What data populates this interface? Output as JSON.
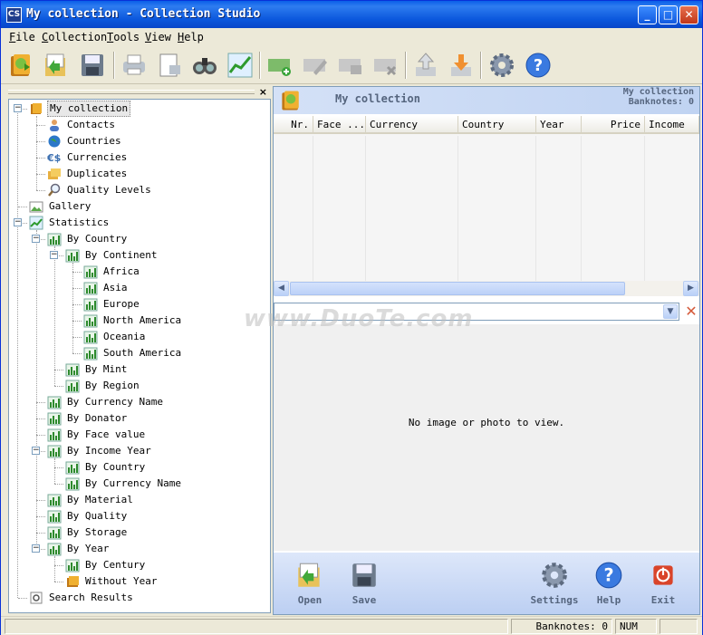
{
  "window": {
    "app_icon": "CS",
    "title": "My collection - Collection Studio"
  },
  "menu": [
    "File",
    "Collection",
    "Tools",
    "View",
    "Help"
  ],
  "toolbar_icons": [
    "open-book-icon",
    "open-folder-icon",
    "save-icon",
    "print-icon",
    "print-preview-icon",
    "binoculars-icon",
    "chart-icon",
    "add-item-icon",
    "edit-item-icon",
    "duplicate-item-icon",
    "delete-item-icon",
    "import-icon",
    "export-icon",
    "settings-icon",
    "help-icon"
  ],
  "left_panel": {
    "close_glyph": "×",
    "tree": [
      {
        "label": "My collection",
        "icon": "book-icon",
        "level": 0
      },
      {
        "label": "Contacts",
        "icon": "contact-icon",
        "level": 1
      },
      {
        "label": "Countries",
        "icon": "globe-icon",
        "level": 1
      },
      {
        "label": "Currencies",
        "icon": "currency-icon",
        "level": 1
      },
      {
        "label": "Duplicates",
        "icon": "duplicates-icon",
        "level": 1
      },
      {
        "label": "Quality Levels",
        "icon": "magnifier-icon",
        "level": 1
      },
      {
        "label": "Gallery",
        "icon": "gallery-icon",
        "level": 0
      },
      {
        "label": "Statistics",
        "icon": "chart-icon",
        "level": 0
      },
      {
        "label": "By Country",
        "icon": "bar-chart-icon",
        "level": 1
      },
      {
        "label": "By Continent",
        "icon": "bar-chart-icon",
        "level": 2
      },
      {
        "label": "Africa",
        "icon": "bar-chart-icon",
        "level": 3
      },
      {
        "label": "Asia",
        "icon": "bar-chart-icon",
        "level": 3
      },
      {
        "label": "Europe",
        "icon": "bar-chart-icon",
        "level": 3
      },
      {
        "label": "North America",
        "icon": "bar-chart-icon",
        "level": 3
      },
      {
        "label": "Oceania",
        "icon": "bar-chart-icon",
        "level": 3
      },
      {
        "label": "South America",
        "icon": "bar-chart-icon",
        "level": 3
      },
      {
        "label": "By Mint",
        "icon": "bar-chart-icon",
        "level": 2
      },
      {
        "label": "By Region",
        "icon": "bar-chart-icon",
        "level": 2
      },
      {
        "label": "By Currency Name",
        "icon": "bar-chart-icon",
        "level": 1
      },
      {
        "label": "By Donator",
        "icon": "bar-chart-icon",
        "level": 1
      },
      {
        "label": "By Face value",
        "icon": "bar-chart-icon",
        "level": 1
      },
      {
        "label": "By Income Year",
        "icon": "bar-chart-icon",
        "level": 1
      },
      {
        "label": "By Country",
        "icon": "bar-chart-icon",
        "level": 2
      },
      {
        "label": "By Currency Name",
        "icon": "bar-chart-icon",
        "level": 2
      },
      {
        "label": "By Material",
        "icon": "bar-chart-icon",
        "level": 1
      },
      {
        "label": "By Quality",
        "icon": "bar-chart-icon",
        "level": 1
      },
      {
        "label": "By Storage",
        "icon": "bar-chart-icon",
        "level": 1
      },
      {
        "label": "By Year",
        "icon": "bar-chart-icon",
        "level": 1
      },
      {
        "label": "By Century",
        "icon": "bar-chart-icon",
        "level": 2
      },
      {
        "label": "Without Year",
        "icon": "folder-book-icon",
        "level": 2
      },
      {
        "label": "Search Results",
        "icon": "search-results-icon",
        "level": 0
      }
    ]
  },
  "right_panel": {
    "header_title": "My collection",
    "header_right_line1": "My collection",
    "header_right_line2": "Banknotes: 0",
    "columns": [
      "Nr.",
      "Face ...",
      "Currency",
      "Country",
      "Year",
      "Price",
      "Income"
    ],
    "no_image_text": "No image or photo to view.",
    "buttons": [
      {
        "label": "Open",
        "icon": "open-folder-icon"
      },
      {
        "label": "Save",
        "icon": "save-icon"
      },
      {
        "label": "Settings",
        "icon": "settings-icon"
      },
      {
        "label": "Help",
        "icon": "help-icon"
      },
      {
        "label": "Exit",
        "icon": "exit-icon"
      }
    ]
  },
  "status_bar": {
    "banknotes": "Banknotes: 0",
    "num": "NUM"
  },
  "watermark": "www.DuoTe.com"
}
